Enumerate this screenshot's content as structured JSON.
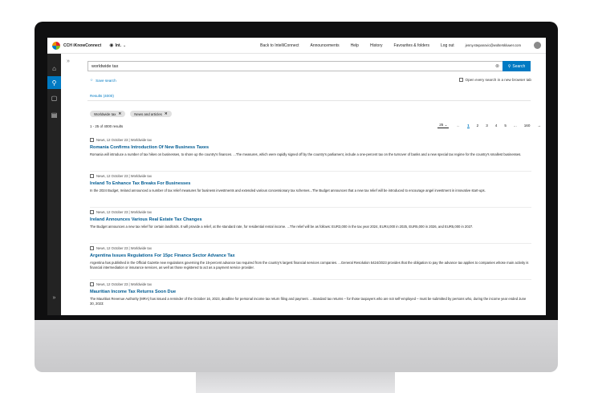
{
  "header": {
    "app_name": "CCH iKnowConnect",
    "region": "Int.",
    "links": [
      "Back to IntelliConnect",
      "Announcements",
      "Help",
      "History",
      "Favourites & folders",
      "Log out"
    ],
    "user_email": "jenny.stepanovic@wolterskluwer.com"
  },
  "search": {
    "query": "worldwide tax",
    "button_label": "Search",
    "save_label": "Save search",
    "new_tab_label": "Open every search in a new browser tab"
  },
  "results_tab": "Results (4000)",
  "filters": [
    "Worldwide tax",
    "News and articles"
  ],
  "result_count": "1 - 25 of 4000 results",
  "pager": {
    "page_size": "25",
    "pages": [
      "1",
      "2",
      "3",
      "4",
      "5",
      "...",
      "160"
    ],
    "current": "1"
  },
  "results": [
    {
      "meta": "News, 12 October 23 | Worldwide tax",
      "title": "Romania Confirms Introduction Of New Business Taxes",
      "snippet": "Romania will introduce a number of tax hikes on businesses, to shore up the country's finances. ...The measures, which were rapidly signed off by the country's parliament, include a one-percent tax on the turnover of banks and a new special tax regime for the country's smallest businesses."
    },
    {
      "meta": "News, 12 October 23 | Worldwide tax",
      "title": "Ireland To Enhance Tax Breaks For Businesses",
      "snippet": "In the 2024 Budget, Ireland announced a number of tax relief measures for business investments and extended various concessionary tax schemes...The Budget announces that a new tax relief will be introduced to encourage angel investment in innovative start-ups."
    },
    {
      "meta": "News, 12 October 23 | Worldwide tax",
      "title": "Ireland Announces Various Real Estate Tax Changes",
      "snippet": "The Budget announces a new tax relief for certain landlords. It will provide a relief, at the standard rate, for residential rental income. ...The relief will be as follows: EUR3,000 in the tax year 2024, EUR4,000 in 2025, EUR5,000 in 2026, and EUR5,000 in 2027."
    },
    {
      "meta": "News, 12 October 23 | Worldwide tax",
      "title": "Argentina Issues Regulations For 15pc Finance Sector Advance Tax",
      "snippet": "Argentina has published in the Official Gazette new regulations governing the 15-percent advance tax required from the country's largest financial services companies. ...General Resolution 5424/2023 provides that the obligation to pay the advance tax applies to companies whose main activity is financial intermediation or insurance services, as well as those registered to act as a payment service provider."
    },
    {
      "meta": "News, 12 October 23 | Worldwide tax",
      "title": "Mauritian Income Tax Returns Soon Due",
      "snippet": "The Mauritius Revenue Authority (MRA) has issued a reminder of the October 16, 2023, deadline for personal income tax return filing and payment. ...Standard tax returns – for those taxpayers who are not self-employed – must be submitted by persons who, during the income year ended June 30, 2023:"
    }
  ]
}
